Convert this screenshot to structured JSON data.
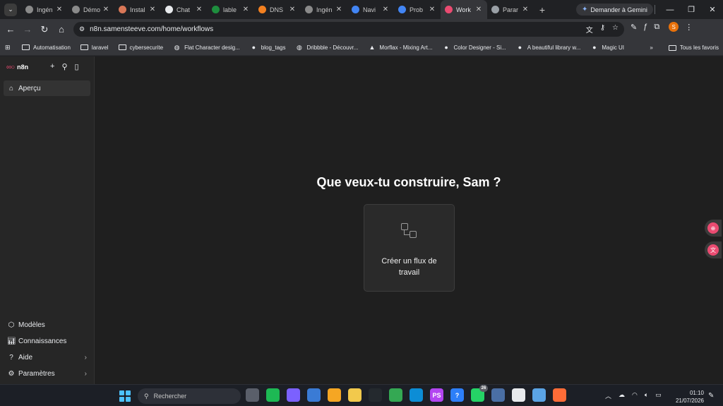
{
  "browser": {
    "tabs": [
      {
        "title": "Ingén",
        "icon": "avatar-icon",
        "color": "#8a8a8a",
        "active": false
      },
      {
        "title": "Démo",
        "icon": "avatar-icon",
        "color": "#8a8a8a",
        "active": false
      },
      {
        "title": "Instal",
        "icon": "claude-icon",
        "color": "#d97757",
        "active": false
      },
      {
        "title": "Chat",
        "icon": "chatgpt-icon",
        "color": "#e8eaed",
        "active": false
      },
      {
        "title": "lable",
        "icon": "leaf-icon",
        "color": "#1e8e3e",
        "active": false
      },
      {
        "title": "DNS",
        "icon": "cloudflare-icon",
        "color": "#f38020",
        "active": false
      },
      {
        "title": "Ingén",
        "icon": "avatar-icon",
        "color": "#8a8a8a",
        "active": false
      },
      {
        "title": "Navi",
        "icon": "google-icon",
        "color": "#4285f4",
        "active": false
      },
      {
        "title": "Prob",
        "icon": "bar-chart-icon",
        "color": "#4285f4",
        "active": false
      },
      {
        "title": "Work",
        "icon": "n8n-icon",
        "color": "#ea4b71",
        "active": true
      },
      {
        "title": "Parar",
        "icon": "gear-icon",
        "color": "#9aa0a6",
        "active": false
      }
    ],
    "gemini_label": "Demander à Gemini",
    "url": "n8n.samensteeve.com/home/workflows",
    "profile_initial": "S",
    "bookmarks": [
      {
        "label": "Automatisation",
        "icon": "folder-icon"
      },
      {
        "label": "laravel",
        "icon": "folder-icon"
      },
      {
        "label": "cybersecurite",
        "icon": "folder-icon"
      },
      {
        "label": "Flat Character desig...",
        "icon": "globe-icon"
      },
      {
        "label": "blog_tags",
        "icon": "blog-icon"
      },
      {
        "label": "Dribbble - Découvr...",
        "icon": "globe-icon"
      },
      {
        "label": "Morflax - Mixing Art...",
        "icon": "morflax-icon"
      },
      {
        "label": "Color Designer - Si...",
        "icon": "color-designer-icon"
      },
      {
        "label": "A beautiful library w...",
        "icon": "library-icon"
      },
      {
        "label": "Magic UI",
        "icon": "magic-ui-icon"
      }
    ],
    "all_bookmarks_label": "Tous les favoris"
  },
  "app": {
    "logo_text": "n8n",
    "nav_top": [
      {
        "label": "Aperçu",
        "icon": "home-icon",
        "selected": true
      }
    ],
    "nav_bottom": [
      {
        "label": "Modèles",
        "icon": "templates-icon",
        "chevron": false
      },
      {
        "label": "Connaissances",
        "icon": "insights-icon",
        "chevron": false
      },
      {
        "label": "Aide",
        "icon": "help-icon",
        "chevron": true
      },
      {
        "label": "Paramètres",
        "icon": "gear-icon",
        "chevron": true
      }
    ],
    "heading": "Que veux-tu construire, Sam ?",
    "create_card_label": "Créer un flux de travail",
    "accent_color": "#ea4b71"
  },
  "taskbar": {
    "search_placeholder": "Rechercher",
    "apps": [
      {
        "name": "task-view-icon",
        "color": "#5a5f6a",
        "label": "",
        "badge": ""
      },
      {
        "name": "spotify-icon",
        "color": "#1db954",
        "label": "",
        "badge": ""
      },
      {
        "name": "copilot-icon",
        "color": "#7b61ff",
        "label": "",
        "badge": ""
      },
      {
        "name": "store-icon",
        "color": "#3a7bd5",
        "label": "",
        "badge": ""
      },
      {
        "name": "search-app-icon",
        "color": "#f5a623",
        "label": "",
        "badge": ""
      },
      {
        "name": "file-explorer-icon",
        "color": "#f2c94c",
        "label": "",
        "badge": ""
      },
      {
        "name": "github-icon",
        "color": "#24292e",
        "label": "",
        "badge": ""
      },
      {
        "name": "chrome-icon",
        "color": "#34a853",
        "label": "",
        "badge": ""
      },
      {
        "name": "edge-icon",
        "color": "#0c8dd6",
        "label": "",
        "badge": ""
      },
      {
        "name": "phpstorm-icon",
        "color": "#b345f1",
        "label": "PS",
        "badge": ""
      },
      {
        "name": "help-app-icon",
        "color": "#2d7ff9",
        "label": "?",
        "badge": ""
      },
      {
        "name": "whatsapp-icon",
        "color": "#25d366",
        "label": "",
        "badge": "26"
      },
      {
        "name": "arc-icon",
        "color": "#4a6fa5",
        "label": "",
        "badge": ""
      },
      {
        "name": "capcut-icon",
        "color": "#e8eaed",
        "label": "",
        "badge": ""
      },
      {
        "name": "network-app-icon",
        "color": "#5ba4e5",
        "label": "",
        "badge": ""
      },
      {
        "name": "postman-icon",
        "color": "#ff6c37",
        "label": "",
        "badge": ""
      }
    ],
    "time": "01:10",
    "date": "21/07/2026"
  }
}
